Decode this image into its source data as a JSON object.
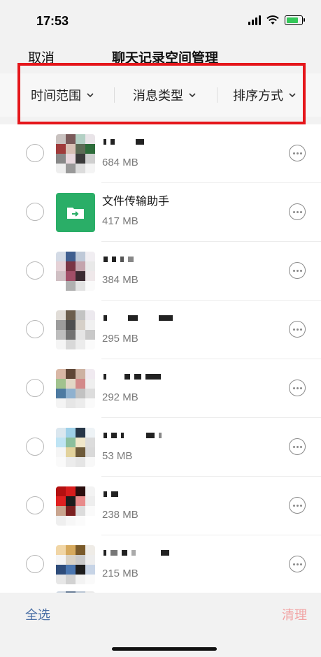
{
  "status": {
    "time": "17:53"
  },
  "nav": {
    "cancel": "取消",
    "title": "聊天记录空间管理"
  },
  "filters": [
    {
      "label": "时间范围"
    },
    {
      "label": "消息类型"
    },
    {
      "label": "排序方式"
    }
  ],
  "rows": [
    {
      "name": "",
      "size": "684 MB"
    },
    {
      "name": "文件传输助手",
      "size": "417 MB"
    },
    {
      "name": "",
      "size": "384 MB"
    },
    {
      "name": "",
      "size": "295 MB"
    },
    {
      "name": "",
      "size": "292 MB"
    },
    {
      "name": "",
      "size": "53 MB"
    },
    {
      "name": "",
      "size": "238 MB"
    },
    {
      "name": "",
      "size": "215 MB"
    }
  ],
  "bottom": {
    "select_all": "全选",
    "clear": "清理"
  },
  "colors": {
    "accent": "#4a6fa5",
    "highlight": "#e5161b",
    "file_helper": "#2aae67",
    "clear_disabled": "#f2a3a3"
  }
}
